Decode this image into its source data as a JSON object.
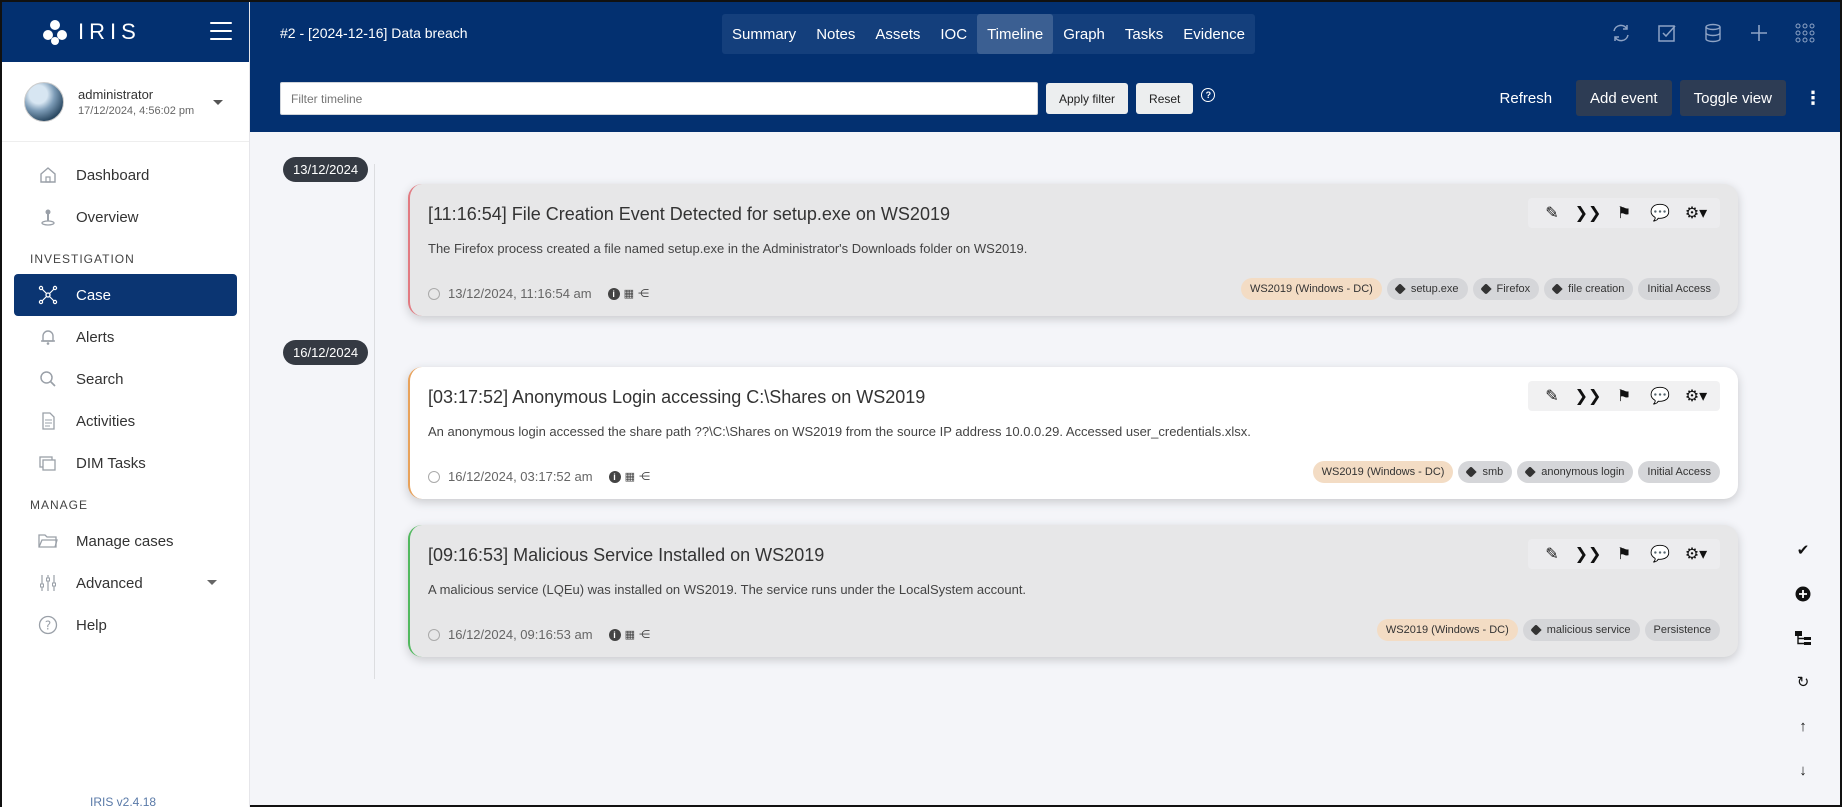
{
  "brand": {
    "name": "IRIS"
  },
  "user": {
    "name": "administrator",
    "timestamp": "17/12/2024, 4:56:02 pm"
  },
  "sidebar": {
    "items": [
      {
        "label": "Dashboard",
        "icon": "home-icon"
      },
      {
        "label": "Overview",
        "icon": "overview-icon"
      },
      {
        "section": "INVESTIGATION"
      },
      {
        "label": "Case",
        "icon": "case-network-icon",
        "active": true
      },
      {
        "label": "Alerts",
        "icon": "bell-icon"
      },
      {
        "label": "Search",
        "icon": "search-icon"
      },
      {
        "label": "Activities",
        "icon": "document-icon"
      },
      {
        "label": "DIM Tasks",
        "icon": "tasks-icon"
      },
      {
        "section": "MANAGE"
      },
      {
        "label": "Manage cases",
        "icon": "folder-icon"
      },
      {
        "label": "Advanced",
        "icon": "sliders-icon"
      },
      {
        "label": "Help",
        "icon": "help-icon"
      }
    ],
    "section_investigation": "INVESTIGATION",
    "section_manage": "MANAGE",
    "version": "IRIS v2.4.18"
  },
  "header": {
    "case_title": "#2 - [2024-12-16] Data breach",
    "tabs": [
      "Summary",
      "Notes",
      "Assets",
      "IOC",
      "Timeline",
      "Graph",
      "Tasks",
      "Evidence"
    ],
    "active_tab": "Timeline"
  },
  "toolbar": {
    "filter_placeholder": "Filter timeline",
    "apply_filter": "Apply filter",
    "reset": "Reset",
    "help": "?",
    "refresh": "Refresh",
    "add_event": "Add event",
    "toggle_view": "Toggle view"
  },
  "timeline": {
    "dates": [
      "13/12/2024",
      "16/12/2024"
    ],
    "events": [
      {
        "title": "[11:16:54] File Creation Event Detected for setup.exe on WS2019",
        "description": "The Firefox process created a file named setup.exe in the Administrator's Downloads folder on WS2019.",
        "datetime": "13/12/2024, 11:16:54 am",
        "asset": "WS2019 (Windows - DC)",
        "tags": [
          "setup.exe",
          "Firefox",
          "file creation"
        ],
        "category": "Initial Access",
        "color": "#e27b82"
      },
      {
        "title": "[03:17:52] Anonymous Login accessing C:\\Shares on WS2019",
        "description": "An anonymous login accessed the share path ??\\C:\\Shares on WS2019 from the source IP address 10.0.0.29. Accessed user_credentials.xlsx.",
        "datetime": "16/12/2024, 03:17:52 am",
        "asset": "WS2019 (Windows - DC)",
        "tags": [
          "smb",
          "anonymous login"
        ],
        "category": "Initial Access",
        "color": "#e8a25b"
      },
      {
        "title": "[09:16:53] Malicious Service Installed on WS2019",
        "description": "A malicious service (LQEu) was installed on WS2019. The service runs under the LocalSystem account.",
        "datetime": "16/12/2024, 09:16:53 am",
        "asset": "WS2019 (Windows - DC)",
        "tags": [
          "malicious service"
        ],
        "category": "Persistence",
        "color": "#52b95f"
      }
    ]
  }
}
